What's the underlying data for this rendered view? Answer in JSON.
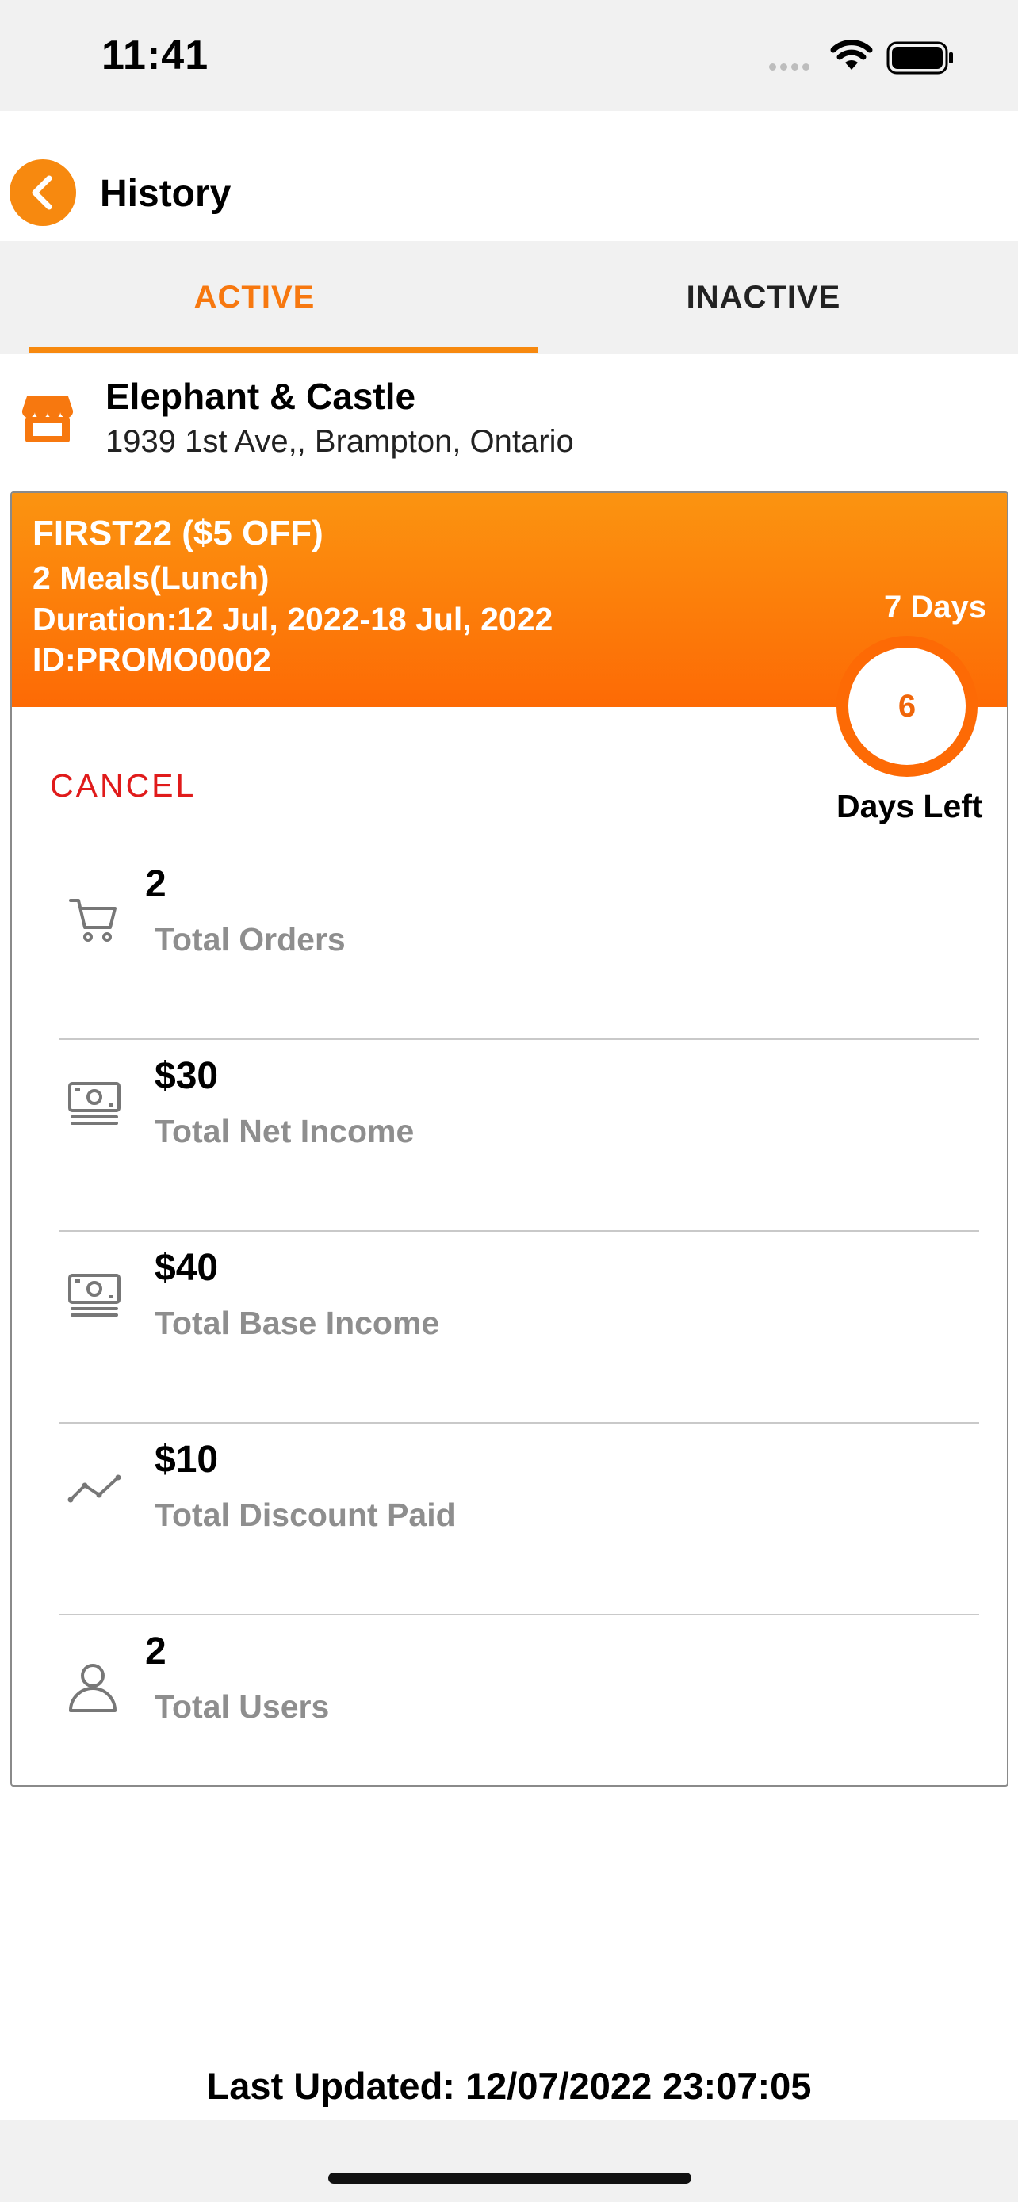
{
  "status_bar": {
    "time": "11:41"
  },
  "header": {
    "title": "History"
  },
  "tabs": [
    {
      "label": "ACTIVE",
      "active": true
    },
    {
      "label": "INACTIVE",
      "active": false
    }
  ],
  "store": {
    "name": "Elephant & Castle",
    "address": "1939 1st Ave,, Brampton, Ontario"
  },
  "promo": {
    "title": "FIRST22 ($5 OFF)",
    "meals": "2 Meals(Lunch)",
    "duration": "Duration:12 Jul, 2022-18 Jul, 2022",
    "id": "ID:PROMO0002",
    "days_total": "7 Days",
    "days_left_value": "6",
    "days_left_label": "Days Left",
    "cancel_label": "CANCEL"
  },
  "stats": [
    {
      "icon": "cart-icon",
      "value": "2",
      "label": "Total Orders"
    },
    {
      "icon": "cash-icon",
      "value": "$30",
      "label": "Total Net Income"
    },
    {
      "icon": "cash-icon",
      "value": "$40",
      "label": "Total Base Income"
    },
    {
      "icon": "trend-line-icon",
      "value": "$10",
      "label": "Total Discount Paid"
    },
    {
      "icon": "user-icon",
      "value": "2",
      "label": "Total Users"
    }
  ],
  "footer": {
    "last_updated": "Last Updated: 12/07/2022 23:07:05"
  },
  "colors": {
    "accent": "#f7890f",
    "banner_top": "#fb9410",
    "banner_bottom": "#fd6a05",
    "cancel": "#e01b1b",
    "muted": "#8e8e8e"
  }
}
